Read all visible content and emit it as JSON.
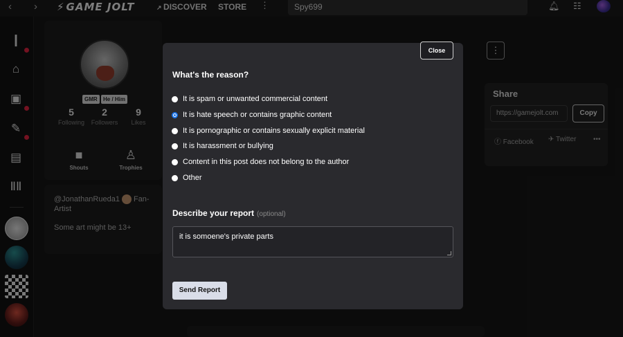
{
  "topbar": {
    "logo": "GAME JOLT",
    "discover": "DISCOVER",
    "store": "STORE",
    "search_value": "Spy699"
  },
  "profile": {
    "tags": [
      "GMR",
      "He / Him"
    ],
    "stats": [
      {
        "value": "5",
        "label": "Following"
      },
      {
        "value": "2",
        "label": "Followers"
      },
      {
        "value": "9",
        "label": "Likes"
      }
    ],
    "cards": [
      {
        "label": "Shouts"
      },
      {
        "label": "Trophies"
      }
    ],
    "bio_handle": "@JonathanRueda1",
    "bio_tail": "Fan-",
    "bio_line2": "Artist",
    "bio_line3": "Some art might be 13+"
  },
  "share": {
    "title": "Share",
    "url": "https://gamejolt.com",
    "copy": "Copy",
    "facebook": "Facebook",
    "twitter": "Twitter"
  },
  "modal": {
    "close": "Close",
    "title": "What's the reason?",
    "reasons": [
      "It is spam or unwanted commercial content",
      "It is hate speech or contains graphic content",
      "It is pornographic or contains sexually explicit material",
      "It is harassment or bullying",
      "Content in this post does not belong to the author",
      "Other"
    ],
    "selected_index": 1,
    "describe_label": "Describe your report",
    "optional": "(optional)",
    "description": "it is somoene's private parts",
    "send": "Send Report"
  },
  "colors": {
    "modal_bg": "#2a2a2e",
    "accent_radio": "#1a73e8",
    "notification_dot": "#d3213c"
  }
}
